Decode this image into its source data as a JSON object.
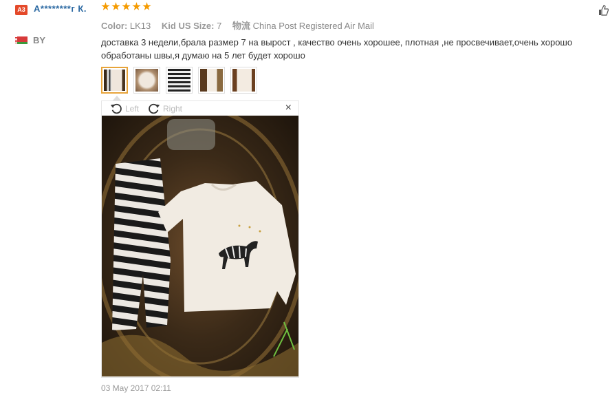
{
  "reviewer": {
    "avatar_label": "A3",
    "name": "A********г К.",
    "country": "BY"
  },
  "rating": {
    "stars": 5,
    "max": 5
  },
  "attributes": [
    {
      "label": "Color:",
      "value": "LK13"
    },
    {
      "label": "Kid US Size:",
      "value": "7"
    },
    {
      "label": "物流",
      "value": "China Post Registered Air Mail"
    }
  ],
  "review_text": "доставка 3 недели,брала размер 7 на вырост , качество очень хорошее, плотная ,не просвечивает,очень хорошо обработаны швы,я думаю на 5 лет будет хорошо",
  "thumbnails": [
    {
      "name": "photo-thumb-1",
      "selected": true
    },
    {
      "name": "photo-thumb-2",
      "selected": false
    },
    {
      "name": "photo-thumb-3",
      "selected": false
    },
    {
      "name": "photo-thumb-4",
      "selected": false
    },
    {
      "name": "photo-thumb-5",
      "selected": false
    }
  ],
  "viewer": {
    "rotate_left_label": "Left",
    "rotate_right_label": "Right",
    "close_symbol": "×"
  },
  "date": "03 May 2017 02:11",
  "icons": {
    "like": "thumbs-up-icon",
    "rotate_left": "rotate-left-icon",
    "rotate_right": "rotate-right-icon",
    "close": "close-icon",
    "flag": "belarus-flag-icon"
  },
  "colors": {
    "accent_star": "#f59b00",
    "username": "#2d6aa3",
    "badge": "#e4492a",
    "selected_thumb_border": "#e8a43a"
  }
}
